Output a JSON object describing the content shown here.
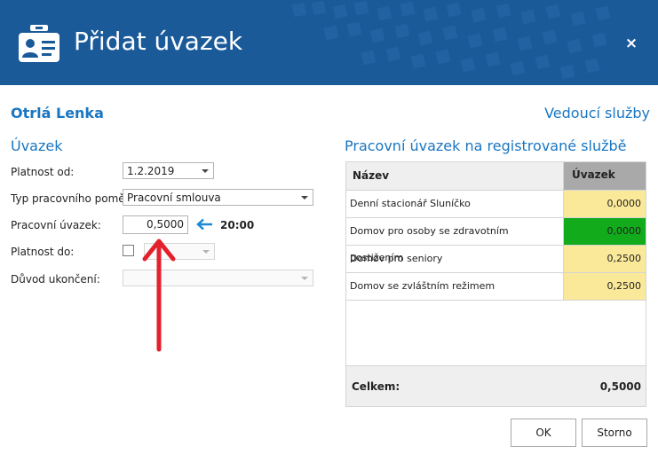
{
  "dialog": {
    "title": "Přidat úvazek",
    "close_label": "×",
    "icon": "id-badge-icon"
  },
  "person_name": "Otrlá Lenka",
  "top_link": "Vedoucí služby",
  "left_section": {
    "title": "Úvazek",
    "fields": {
      "platnost_od": {
        "label": "Platnost od:",
        "value": "1.2.2019"
      },
      "typ_pomeru": {
        "label": "Typ pracovního poměru:",
        "value": "Pracovní smlouva"
      },
      "uvazek": {
        "label": "Pracovní úvazek:",
        "value": "0,5000",
        "hours": "20:00"
      },
      "platnost_do": {
        "label": "Platnost do:",
        "checked": false,
        "value": ""
      },
      "duvod": {
        "label": "Důvod ukončení:",
        "value": ""
      }
    }
  },
  "right_section": {
    "title": "Pracovní úvazek na registrované službě",
    "columns": [
      "Název",
      "Úvazek"
    ],
    "rows": [
      {
        "name": "Denní stacionář Sluníčko",
        "value": "0,0000",
        "color": "#fbe99a"
      },
      {
        "name": "Domov pro osoby se zdravotním postižením",
        "value": "0,0000",
        "color": "#12ab1b"
      },
      {
        "name": "Domov pro seniory",
        "value": "0,2500",
        "color": "#fbe99a"
      },
      {
        "name": "Domov se zvláštním režimem",
        "value": "0,2500",
        "color": "#fbe99a"
      }
    ],
    "total_label": "Celkem:",
    "total_value": "0,5000"
  },
  "buttons": {
    "ok": "OK",
    "cancel": "Storno"
  },
  "colors": {
    "header_bg": "#1b5a99",
    "accent": "#1a76c2",
    "annotation_arrow": "#e3202b",
    "pointer_arrow": "#1a8ad8"
  }
}
